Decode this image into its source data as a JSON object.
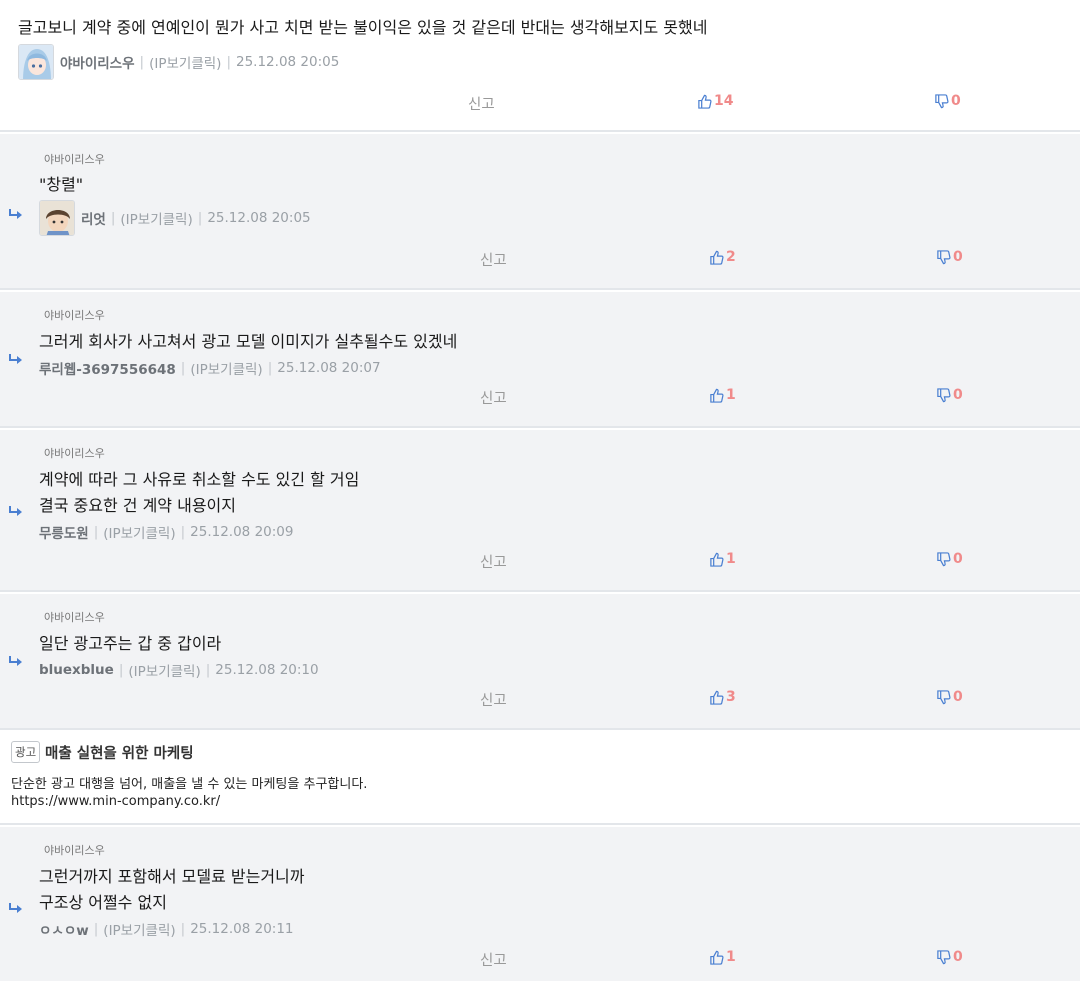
{
  "main": {
    "text": "글고보니 계약 중에 연예인이 뭔가 사고 치면 받는 불이익은 있을 것 같은데 반대는 생각해보지도 못했네",
    "author": "야바이리스우",
    "ip": "(IP보기클릭)",
    "date": "25.12.08 20:05",
    "report": "신고",
    "likes": "14",
    "dislikes": "0"
  },
  "replies": [
    {
      "to": "야바이리스우",
      "lines": [
        "\"창렬\""
      ],
      "author": "리엇",
      "ip": "(IP보기클릭)",
      "date": "25.12.08 20:05",
      "report": "신고",
      "likes": "2",
      "dislikes": "0"
    },
    {
      "to": "야바이리스우",
      "lines": [
        "그러게 회사가 사고쳐서 광고 모델 이미지가 실추될수도 있겠네"
      ],
      "author": "루리웹-3697556648",
      "ip": "(IP보기클릭)",
      "date": "25.12.08 20:07",
      "report": "신고",
      "likes": "1",
      "dislikes": "0"
    },
    {
      "to": "야바이리스우",
      "lines": [
        "계약에 따라 그 사유로 취소할 수도 있긴 할 거임",
        "결국 중요한 건 계약 내용이지"
      ],
      "author": "무릉도원",
      "ip": "(IP보기클릭)",
      "date": "25.12.08 20:09",
      "report": "신고",
      "likes": "1",
      "dislikes": "0"
    },
    {
      "to": "야바이리스우",
      "lines": [
        "일단 광고주는 갑 중 갑이라"
      ],
      "author": "bluexblue",
      "ip": "(IP보기클릭)",
      "date": "25.12.08 20:10",
      "report": "신고",
      "likes": "3",
      "dislikes": "0"
    },
    {
      "to": "야바이리스우",
      "lines": [
        "그런거까지 포함해서 모델료 받는거니까",
        "구조상 어쩔수 없지"
      ],
      "author": "ㅇㅅㅇw",
      "ip": "(IP보기클릭)",
      "date": "25.12.08 20:11",
      "report": "신고",
      "likes": "1",
      "dislikes": "0"
    }
  ],
  "ad": {
    "badge": "광고",
    "title": "매출 실현을 위한 마케팅",
    "description": "단순한 광고 대행을 넘어, 매출을 낼 수 있는 마케팅을 추구합니다.",
    "url": "https://www.min-company.co.kr/"
  },
  "colors": {
    "reply_bg": "#f2f3f5",
    "accent_blue": "#4a7fd1",
    "vote_count": "#f08a8a",
    "divider": "#e3e6ea"
  },
  "icons": {
    "reply_arrow": "reply-arrow-icon",
    "thumbs_up": "thumbs-up-icon",
    "thumbs_down": "thumbs-down-icon"
  }
}
